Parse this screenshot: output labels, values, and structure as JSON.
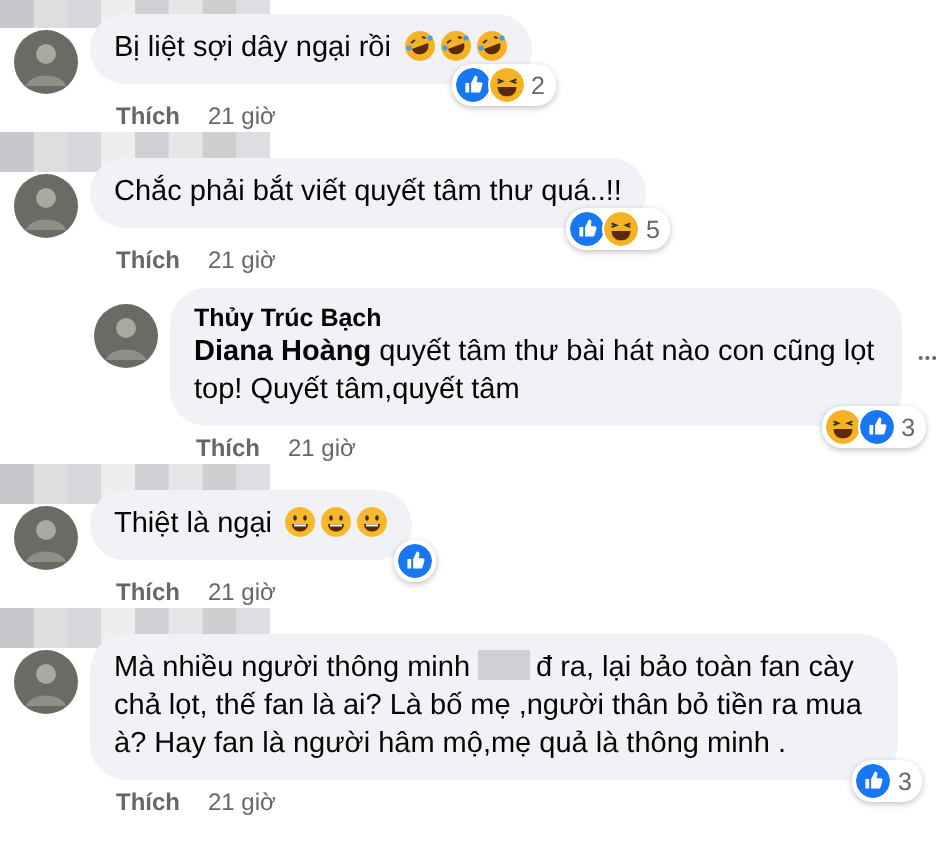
{
  "comments": [
    {
      "redacted": true,
      "segments": [
        {
          "kind": "text",
          "text": "Bị liệt sợi dây ngại rồi"
        }
      ],
      "emojis": [
        {
          "kind": "rofl"
        },
        {
          "kind": "rofl"
        },
        {
          "kind": "rofl"
        }
      ],
      "reactions": [
        {
          "kind": "like"
        },
        {
          "kind": "haha"
        }
      ],
      "reaction_count": "2",
      "like_label": "Thích",
      "time": "21 giờ"
    },
    {
      "redacted": true,
      "segments": [
        {
          "kind": "text",
          "text": "Chắc phải bắt viết quyết tâm thư quá..!!"
        }
      ],
      "reactions": [
        {
          "kind": "like"
        },
        {
          "kind": "haha"
        }
      ],
      "reaction_count": "5",
      "like_label": "Thích",
      "time": "21 giờ",
      "children": [
        {
          "name": "Thủy Trúc Bạch",
          "menu": true,
          "segments": [
            {
              "kind": "text",
              "text": "**Diana Hoàng** quyết tâm thư bài hát nào con cũng lọt top! Quyết tâm,quyết tâm"
            }
          ],
          "reactions": [
            {
              "kind": "haha"
            },
            {
              "kind": "like"
            }
          ],
          "reaction_count": "3",
          "like_label": "Thích",
          "time": "21 giờ"
        }
      ]
    },
    {
      "redacted": true,
      "segments": [
        {
          "kind": "text",
          "text": "Thiệt là ngại"
        }
      ],
      "emojis": [
        {
          "kind": "smile"
        },
        {
          "kind": "smile"
        },
        {
          "kind": "smile"
        }
      ],
      "reactions": [
        {
          "kind": "like"
        }
      ],
      "like_label": "Thích",
      "time": "21 giờ"
    },
    {
      "redacted": true,
      "segments": [
        {
          "kind": "fragment",
          "text": "Mà nhiều người thông minh"
        },
        {
          "kind": "redaction"
        },
        {
          "kind": "fragment",
          "text": "đ ra, lại bảo toàn fan cày"
        },
        {
          "kind": "block",
          "text": "chả lọt, thế fan là ai? Là bố mẹ ,người thân bỏ tiền ra mua à? Hay fan là người hâm mộ,mẹ quả là thông minh ."
        }
      ],
      "reactions": [
        {
          "kind": "like"
        }
      ],
      "reaction_count": "3",
      "like_label": "Thích",
      "time": "21 giờ"
    }
  ]
}
